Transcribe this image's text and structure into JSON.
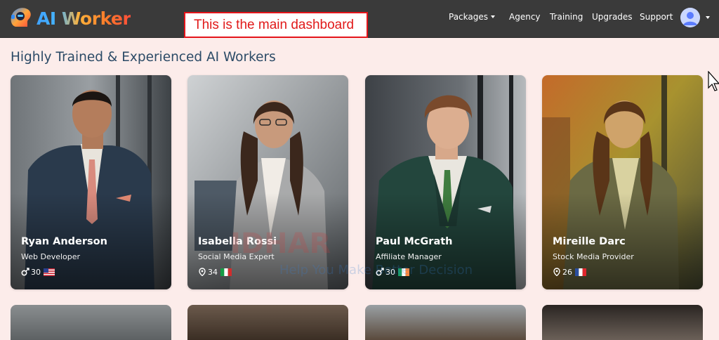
{
  "app": {
    "brand_prefix": "AI",
    "brand_name": "Worker",
    "annotation": "This is the main dashboard"
  },
  "nav": {
    "items": [
      {
        "label": "Packages",
        "has_dropdown": true
      },
      {
        "label": "Agency"
      },
      {
        "label": "Training"
      },
      {
        "label": "Upgrades"
      },
      {
        "label": "Support"
      }
    ],
    "avatar_icon": "user-avatar-icon"
  },
  "section": {
    "title": "Highly Trained & Experienced AI Workers"
  },
  "workers": [
    {
      "name": "Ryan Anderson",
      "role": "Web Developer",
      "age": "30",
      "gender_icon": "male-icon",
      "flag": "us-flag-icon"
    },
    {
      "name": "Isabella Rossi",
      "role": "Social Media Expert",
      "age": "34",
      "gender_icon": "location-pin-icon",
      "flag": "italy-flag-icon"
    },
    {
      "name": "Paul McGrath",
      "role": "Affiliate Manager",
      "age": "30",
      "gender_icon": "male-icon",
      "flag": "ireland-flag-icon"
    },
    {
      "name": "Mireille Darc",
      "role": "Stock Media Provider",
      "age": "26",
      "gender_icon": "location-pin-icon",
      "flag": "france-flag-icon"
    }
  ],
  "colors": {
    "navbar": "#3a3a3a",
    "page_bg": "#fcecea",
    "title": "#2b4a66",
    "annotation_border": "#e4141a"
  }
}
